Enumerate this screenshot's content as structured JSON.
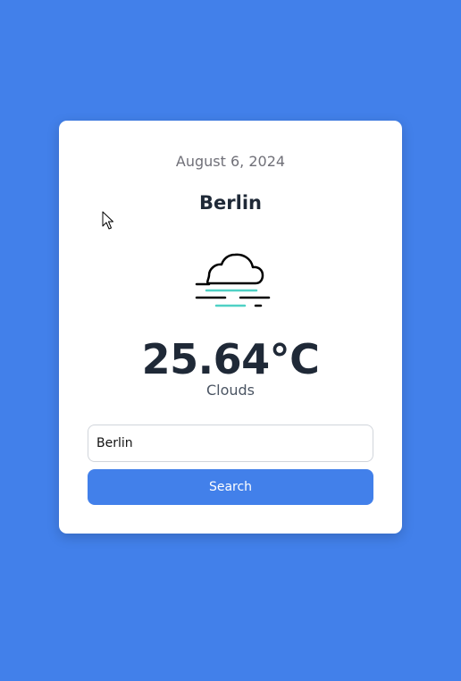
{
  "weather": {
    "date": "August 6, 2024",
    "city": "Berlin",
    "icon": "fog-cloud-icon",
    "temperature": "25.64°C",
    "condition": "Clouds"
  },
  "search": {
    "input_value": "Berlin",
    "button_label": "Search"
  },
  "colors": {
    "background": "#4280ea",
    "card": "#ffffff",
    "button": "#4280ea",
    "fog_accent": "#4fd1c5",
    "text_dark": "#1f2937"
  }
}
